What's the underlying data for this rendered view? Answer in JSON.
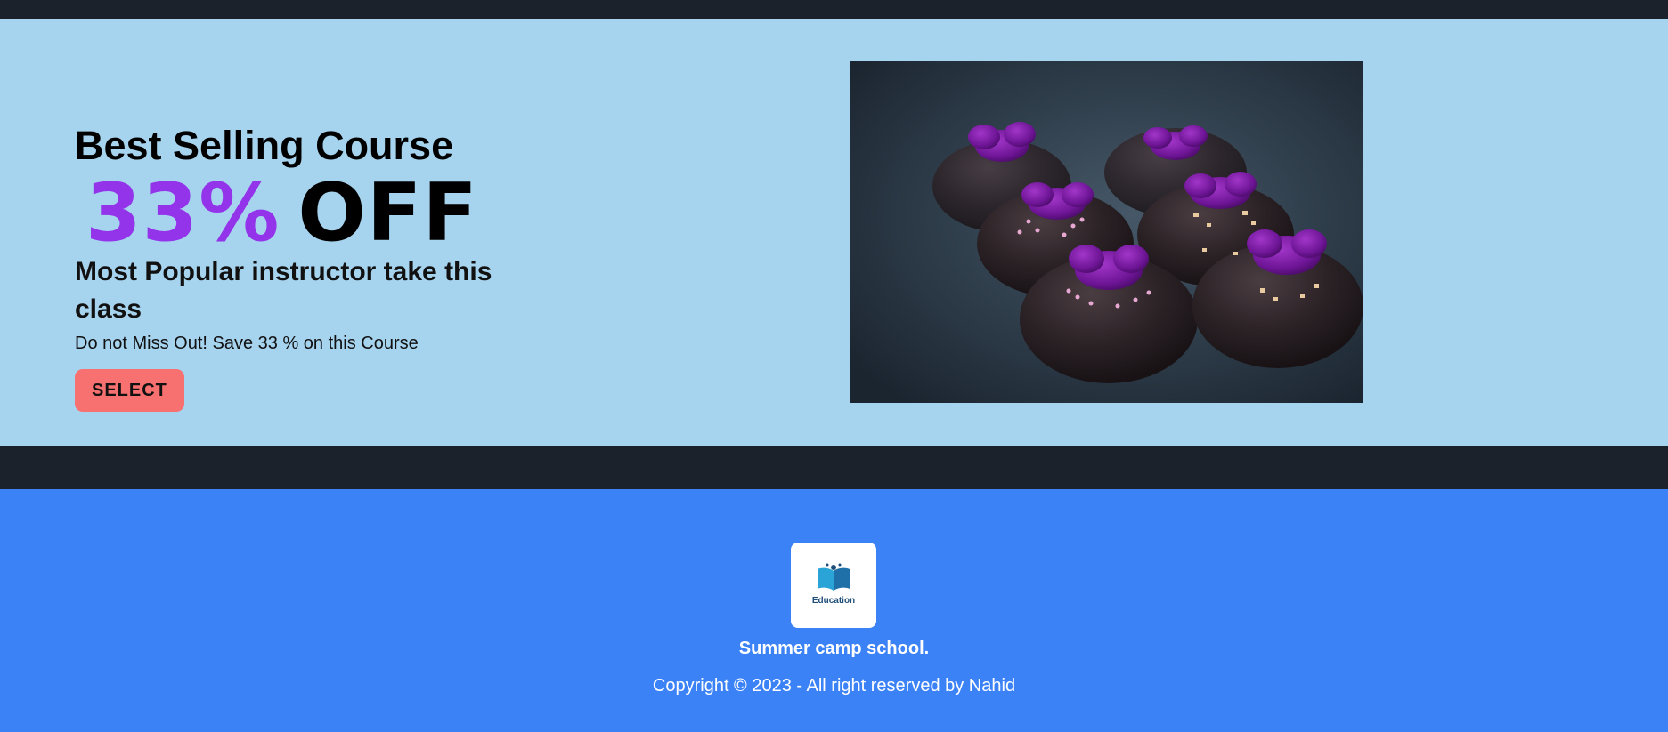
{
  "promo": {
    "headline": "Best Selling Course",
    "discount_percent": "33%",
    "discount_word": "OFF",
    "subheadline": "Most Popular instructor take this class",
    "tagline": "Do not Miss Out! Save 33 % on this Course",
    "button_label": "SELECT",
    "image_alt": "chocolate donuts with purple flowers"
  },
  "footer": {
    "logo_text": "Education",
    "school_name": "Summer camp school.",
    "copyright": "Copyright © 2023 - All right reserved by Nahid"
  },
  "colors": {
    "topbar": "#1c222b",
    "promo_bg": "#a6d3ee",
    "discount_accent": "#9333ea",
    "button_bg": "#f87171",
    "footer_bg": "#3b82f6"
  }
}
